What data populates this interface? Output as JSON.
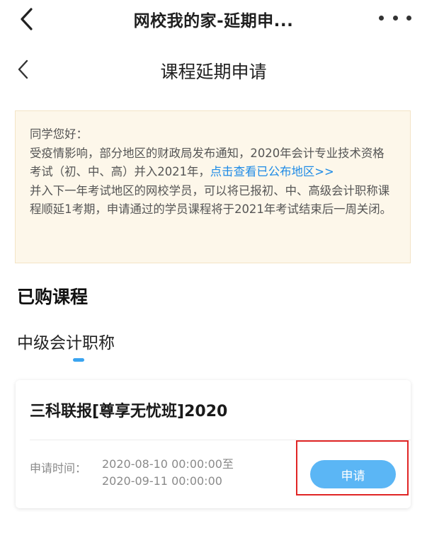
{
  "topbar": {
    "title": "网校我的家-延期申...",
    "back_icon": "chevron-left-icon",
    "more_icon": "more-dots-icon"
  },
  "subbar": {
    "title": "课程延期申请",
    "back_icon": "chevron-left-icon"
  },
  "notice": {
    "greeting": "同学您好：",
    "paragraph1_before_link": "受疫情影响，部分地区的财政局发布通知，2020年会计专业技术资格考试（初、中、高）并入2021年，",
    "link_text": "点击查看已公布地区>>",
    "paragraph2": "并入下一年考试地区的网校学员，可以将已报初、中、高级会计职称课程顺延1考期，申请通过的学员课程将于2021年考试结束后一周关闭。"
  },
  "purchased": {
    "title": "已购课程"
  },
  "tabs": [
    {
      "label": "中级会计职称",
      "active": true
    }
  ],
  "courses": [
    {
      "title": "三科联报[尊享无忧班]2020",
      "time_label": "申请时间：",
      "time_start": "2020-08-10 00:00:00至",
      "time_end": "2020-09-11 00:00:00",
      "apply_label": "申请"
    }
  ],
  "colors": {
    "accent": "#3aa4f0",
    "button": "#5bb6f5",
    "link": "#1e8be6",
    "notice_bg": "#fdf7ea",
    "highlight": "#e02525"
  }
}
